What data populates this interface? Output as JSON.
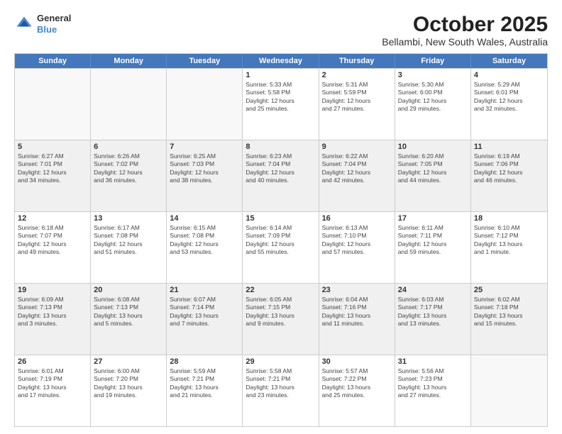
{
  "header": {
    "logo": {
      "general": "General",
      "blue": "Blue"
    },
    "title": "October 2025",
    "subtitle": "Bellambi, New South Wales, Australia"
  },
  "weekdays": [
    "Sunday",
    "Monday",
    "Tuesday",
    "Wednesday",
    "Thursday",
    "Friday",
    "Saturday"
  ],
  "weeks": [
    [
      {
        "day": "",
        "info": ""
      },
      {
        "day": "",
        "info": ""
      },
      {
        "day": "",
        "info": ""
      },
      {
        "day": "1",
        "info": "Sunrise: 5:33 AM\nSunset: 5:58 PM\nDaylight: 12 hours\nand 25 minutes."
      },
      {
        "day": "2",
        "info": "Sunrise: 5:31 AM\nSunset: 5:59 PM\nDaylight: 12 hours\nand 27 minutes."
      },
      {
        "day": "3",
        "info": "Sunrise: 5:30 AM\nSunset: 6:00 PM\nDaylight: 12 hours\nand 29 minutes."
      },
      {
        "day": "4",
        "info": "Sunrise: 5:29 AM\nSunset: 6:01 PM\nDaylight: 12 hours\nand 32 minutes."
      }
    ],
    [
      {
        "day": "5",
        "info": "Sunrise: 6:27 AM\nSunset: 7:01 PM\nDaylight: 12 hours\nand 34 minutes."
      },
      {
        "day": "6",
        "info": "Sunrise: 6:26 AM\nSunset: 7:02 PM\nDaylight: 12 hours\nand 36 minutes."
      },
      {
        "day": "7",
        "info": "Sunrise: 6:25 AM\nSunset: 7:03 PM\nDaylight: 12 hours\nand 38 minutes."
      },
      {
        "day": "8",
        "info": "Sunrise: 6:23 AM\nSunset: 7:04 PM\nDaylight: 12 hours\nand 40 minutes."
      },
      {
        "day": "9",
        "info": "Sunrise: 6:22 AM\nSunset: 7:04 PM\nDaylight: 12 hours\nand 42 minutes."
      },
      {
        "day": "10",
        "info": "Sunrise: 6:20 AM\nSunset: 7:05 PM\nDaylight: 12 hours\nand 44 minutes."
      },
      {
        "day": "11",
        "info": "Sunrise: 6:19 AM\nSunset: 7:06 PM\nDaylight: 12 hours\nand 46 minutes."
      }
    ],
    [
      {
        "day": "12",
        "info": "Sunrise: 6:18 AM\nSunset: 7:07 PM\nDaylight: 12 hours\nand 49 minutes."
      },
      {
        "day": "13",
        "info": "Sunrise: 6:17 AM\nSunset: 7:08 PM\nDaylight: 12 hours\nand 51 minutes."
      },
      {
        "day": "14",
        "info": "Sunrise: 6:15 AM\nSunset: 7:08 PM\nDaylight: 12 hours\nand 53 minutes."
      },
      {
        "day": "15",
        "info": "Sunrise: 6:14 AM\nSunset: 7:09 PM\nDaylight: 12 hours\nand 55 minutes."
      },
      {
        "day": "16",
        "info": "Sunrise: 6:13 AM\nSunset: 7:10 PM\nDaylight: 12 hours\nand 57 minutes."
      },
      {
        "day": "17",
        "info": "Sunrise: 6:11 AM\nSunset: 7:11 PM\nDaylight: 12 hours\nand 59 minutes."
      },
      {
        "day": "18",
        "info": "Sunrise: 6:10 AM\nSunset: 7:12 PM\nDaylight: 13 hours\nand 1 minute."
      }
    ],
    [
      {
        "day": "19",
        "info": "Sunrise: 6:09 AM\nSunset: 7:13 PM\nDaylight: 13 hours\nand 3 minutes."
      },
      {
        "day": "20",
        "info": "Sunrise: 6:08 AM\nSunset: 7:13 PM\nDaylight: 13 hours\nand 5 minutes."
      },
      {
        "day": "21",
        "info": "Sunrise: 6:07 AM\nSunset: 7:14 PM\nDaylight: 13 hours\nand 7 minutes."
      },
      {
        "day": "22",
        "info": "Sunrise: 6:05 AM\nSunset: 7:15 PM\nDaylight: 13 hours\nand 9 minutes."
      },
      {
        "day": "23",
        "info": "Sunrise: 6:04 AM\nSunset: 7:16 PM\nDaylight: 13 hours\nand 11 minutes."
      },
      {
        "day": "24",
        "info": "Sunrise: 6:03 AM\nSunset: 7:17 PM\nDaylight: 13 hours\nand 13 minutes."
      },
      {
        "day": "25",
        "info": "Sunrise: 6:02 AM\nSunset: 7:18 PM\nDaylight: 13 hours\nand 15 minutes."
      }
    ],
    [
      {
        "day": "26",
        "info": "Sunrise: 6:01 AM\nSunset: 7:19 PM\nDaylight: 13 hours\nand 17 minutes."
      },
      {
        "day": "27",
        "info": "Sunrise: 6:00 AM\nSunset: 7:20 PM\nDaylight: 13 hours\nand 19 minutes."
      },
      {
        "day": "28",
        "info": "Sunrise: 5:59 AM\nSunset: 7:21 PM\nDaylight: 13 hours\nand 21 minutes."
      },
      {
        "day": "29",
        "info": "Sunrise: 5:58 AM\nSunset: 7:21 PM\nDaylight: 13 hours\nand 23 minutes."
      },
      {
        "day": "30",
        "info": "Sunrise: 5:57 AM\nSunset: 7:22 PM\nDaylight: 13 hours\nand 25 minutes."
      },
      {
        "day": "31",
        "info": "Sunrise: 5:56 AM\nSunset: 7:23 PM\nDaylight: 13 hours\nand 27 minutes."
      },
      {
        "day": "",
        "info": ""
      }
    ]
  ]
}
